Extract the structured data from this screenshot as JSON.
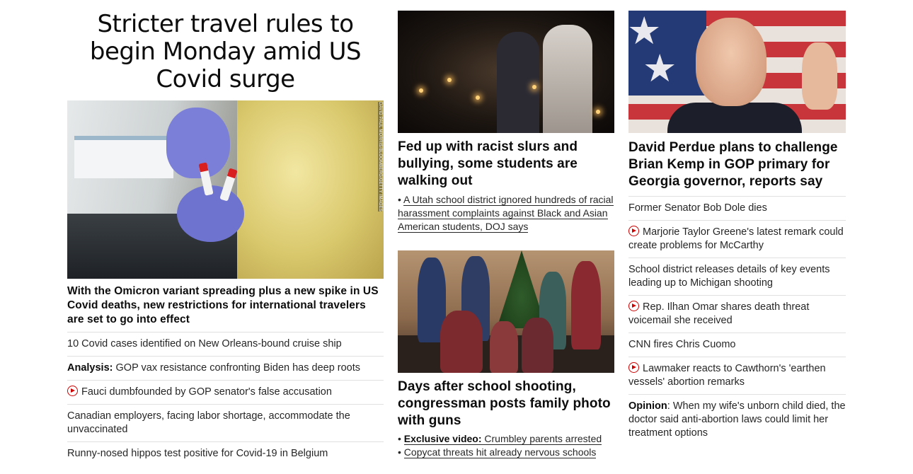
{
  "lead": {
    "headline": "Stricter travel rules to begin Monday amid US Covid surge",
    "photo_credit": "DAVID PAUL MORRIS/BLOOMBERG/GETTY IMAGES",
    "subheadline": "With the Omicron variant spreading plus a new spike in US Covid deaths, new restrictions for international travelers are set to go into effect",
    "items": [
      {
        "prefix": "",
        "text": "10 Covid cases identified on New Orleans-bound cruise ship",
        "video": false
      },
      {
        "prefix": "Analysis:",
        "text": " GOP vax resistance confronting Biden has deep roots",
        "video": false
      },
      {
        "prefix": "",
        "text": "Fauci dumbfounded by GOP senator's false accusation",
        "video": true
      },
      {
        "prefix": "",
        "text": "Canadian employers, facing labor shortage, accommodate the unvaccinated",
        "video": false
      },
      {
        "prefix": "",
        "text": "Runny-nosed hippos test positive for Covid-19 in Belgium",
        "video": false
      }
    ]
  },
  "middle": {
    "story1": {
      "headline": "Fed up with racist slurs and bullying, some students are walking out",
      "bullet_marker": "•",
      "bullet": "A Utah school district ignored hundreds of racial harassment complaints against Black and Asian American students, DOJ says"
    },
    "story2": {
      "headline": "Days after school shooting, congressman posts family photo with guns",
      "bullets": [
        {
          "prefix": "Exclusive video:",
          "text": " Crumbley parents arrested"
        },
        {
          "prefix": "",
          "text": "Copycat threats hit already nervous schools"
        }
      ]
    }
  },
  "right": {
    "headline": "David Perdue plans to challenge Brian Kemp in GOP primary for Georgia governor, reports say",
    "items": [
      {
        "prefix": "",
        "text": "Former Senator Bob Dole dies",
        "video": false
      },
      {
        "prefix": "",
        "text": "Marjorie Taylor Greene's latest remark could create problems for McCarthy",
        "video": true
      },
      {
        "prefix": "",
        "text": "School district releases details of key events leading up to Michigan shooting",
        "video": false
      },
      {
        "prefix": "",
        "text": "Rep. Ilhan Omar shares death threat voicemail she received",
        "video": true
      },
      {
        "prefix": "",
        "text": "CNN fires Chris Cuomo",
        "video": false
      },
      {
        "prefix": "",
        "text": "Lawmaker reacts to Cawthorn's 'earthen vessels' abortion remarks",
        "video": true
      },
      {
        "prefix": "Opinion",
        "text": ": When my wife's unborn child died, the doctor said anti-abortion laws could limit her treatment options",
        "video": false
      }
    ]
  },
  "colors": {
    "text": "#0c0c0c",
    "video_accent": "#cc0000",
    "divider": "#e0e0e0"
  }
}
